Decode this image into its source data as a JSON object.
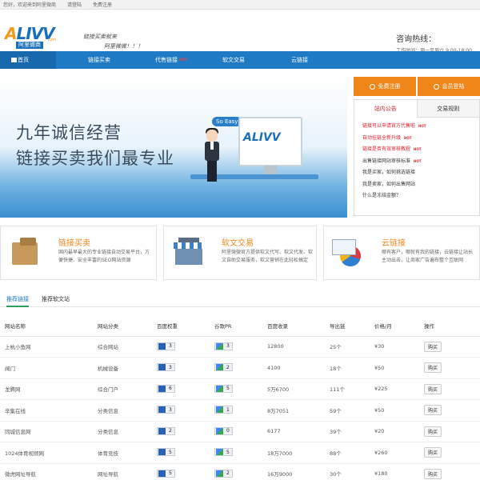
{
  "topbar": {
    "welcome": "您好，欢迎来到阿里微商",
    "login": "请登陆",
    "register": "免费注册"
  },
  "header": {
    "logo_text_a": "A",
    "logo_text_rest": "LIVV",
    "logo_tag": "阿里微商",
    "logo_com": ".com",
    "slogan_line1": "链接买卖就来",
    "slogan_line2": "阿里微微！！！",
    "hotline_title": "咨询热线：",
    "hotline_hours": "工作时间：周一至周六 9:00-18:00"
  },
  "nav": {
    "items": [
      "首页",
      "链接买卖",
      "代售链接",
      "软文交易",
      "云链接"
    ],
    "hot_badge": "HOT"
  },
  "banner": {
    "line1": "九年诚信经营",
    "line2": "链接买卖我们最专业",
    "bubble": "So Easy",
    "monitor_logo": "ALIVV"
  },
  "side": {
    "register_label": "免费注册",
    "login_label": "会员登陆",
    "tabs": [
      "站内公告",
      "交易规则"
    ],
    "notices": [
      {
        "text": "链接可以申请官方代售啦",
        "red": true,
        "hot": true
      },
      {
        "text": "自动挂链全新升级",
        "red": true,
        "hot": true
      },
      {
        "text": "链接是否有效审核教程",
        "red": true,
        "hot": true
      },
      {
        "text": "出售链接网站审核标准",
        "red": false,
        "hot": true
      },
      {
        "text": "我是买家，如何挑选链接",
        "red": false,
        "hot": false
      },
      {
        "text": "我是卖家，如何出售网站",
        "red": false,
        "hot": false
      },
      {
        "text": "什么是冻结金额？",
        "red": false,
        "hot": false
      }
    ],
    "hot_badge": "HOT"
  },
  "features": [
    {
      "title": "链接买卖",
      "desc": "国内最早最大的专业链接自动交易平台，方便快捷、安全丰富的SEO网站资源"
    },
    {
      "title": "软文交易",
      "desc": "阿里微微官方提供软文代写、软文代发、软文自助交易服务，软文营销在此轻松搞定"
    },
    {
      "title": "云链接",
      "desc": "哪有客户，哪就有我的链接，云链接让站长主动出击，让商家广告遍布整个互联网"
    }
  ],
  "list_tabs": [
    "推荐链接",
    "推荐软文站"
  ],
  "table": {
    "headers": [
      "网站名称",
      "网站分类",
      "百度权重",
      "谷歌PR",
      "百度收录",
      "导出链",
      "价格/月",
      "操作"
    ],
    "rows": [
      {
        "name": "上杭小鱼网",
        "cat": "综合网站",
        "br": "3",
        "pr": "3",
        "sl": "12800",
        "out": "25个",
        "price": "¥30",
        "op": "购买"
      },
      {
        "name": "阀门",
        "cat": "机械设备",
        "br": "3",
        "pr": "2",
        "sl": "4100",
        "out": "18个",
        "price": "¥50",
        "op": "购买"
      },
      {
        "name": "龙腾网",
        "cat": "综合门户",
        "br": "6",
        "pr": "5",
        "sl": "5万6700",
        "out": "111个",
        "price": "¥225",
        "op": "购买"
      },
      {
        "name": "辛集在线",
        "cat": "分类信息",
        "br": "3",
        "pr": "1",
        "sl": "8万7051",
        "out": "59个",
        "price": "¥50",
        "op": "购买"
      },
      {
        "name": "同城信息网",
        "cat": "分类信息",
        "br": "2",
        "pr": "0",
        "sl": "6177",
        "out": "39个",
        "price": "¥20",
        "op": "购买"
      },
      {
        "name": "1024体育视频网",
        "cat": "体育竞技",
        "br": "5",
        "pr": "5",
        "sl": "18万7000",
        "out": "88个",
        "price": "¥260",
        "op": "购买"
      },
      {
        "name": "微虎网址导航",
        "cat": "网址导航",
        "br": "5",
        "pr": "2",
        "sl": "16万9000",
        "out": "30个",
        "price": "¥180",
        "op": "购买"
      }
    ]
  }
}
